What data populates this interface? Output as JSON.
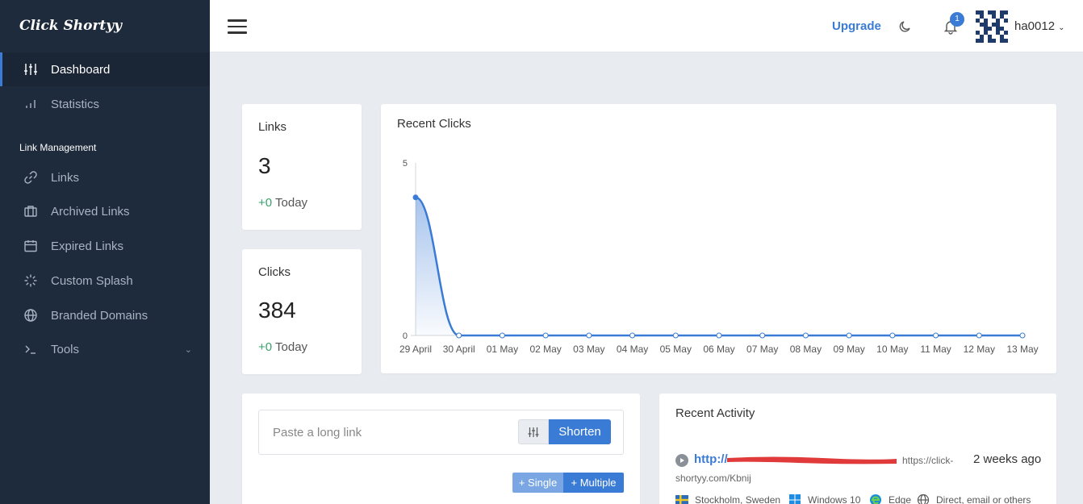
{
  "brand": "Click Shortyy",
  "sidebar": {
    "items": [
      {
        "label": "Dashboard",
        "icon": "sliders-icon"
      },
      {
        "label": "Statistics",
        "icon": "bar-chart-icon"
      }
    ],
    "section_label": "Link Management",
    "link_items": [
      {
        "label": "Links",
        "icon": "link-icon"
      },
      {
        "label": "Archived Links",
        "icon": "briefcase-icon"
      },
      {
        "label": "Expired Links",
        "icon": "calendar-icon"
      },
      {
        "label": "Custom Splash",
        "icon": "loader-icon"
      },
      {
        "label": "Branded Domains",
        "icon": "globe-icon"
      },
      {
        "label": "Tools",
        "icon": "terminal-icon"
      }
    ]
  },
  "topbar": {
    "upgrade": "Upgrade",
    "notification_count": "1",
    "username": "ha0012"
  },
  "stats": {
    "links": {
      "title": "Links",
      "value": "3",
      "today_delta": "+0",
      "today_label": "Today"
    },
    "clicks": {
      "title": "Clicks",
      "value": "384",
      "today_delta": "+0",
      "today_label": "Today"
    }
  },
  "recent_clicks": {
    "title": "Recent Clicks"
  },
  "chart_data": {
    "type": "area",
    "categories": [
      "29 April",
      "30 April",
      "01 May",
      "02 May",
      "03 May",
      "04 May",
      "05 May",
      "06 May",
      "07 May",
      "08 May",
      "09 May",
      "10 May",
      "11 May",
      "12 May",
      "13 May"
    ],
    "series": [
      {
        "values": [
          4,
          0,
          0,
          0,
          0,
          0,
          0,
          0,
          0,
          0,
          0,
          0,
          0,
          0,
          0
        ]
      }
    ],
    "ylim": [
      0,
      5
    ],
    "yticks": [
      "0",
      "5"
    ],
    "color": "#3a7bd5",
    "grid": false
  },
  "shorten": {
    "placeholder": "Paste a long link",
    "button": "Shorten",
    "single": "+ Single",
    "multiple": "+ Multiple"
  },
  "activity": {
    "title": "Recent Activity",
    "link": "http://",
    "short_url_part1": "https://click-",
    "short_url_part2": "shortyy.com/Kbnij",
    "time": "2 weeks ago",
    "location": "Stockholm, Sweden",
    "os": "Windows 10",
    "browser": "Edge",
    "referrer": "Direct, email or others"
  }
}
